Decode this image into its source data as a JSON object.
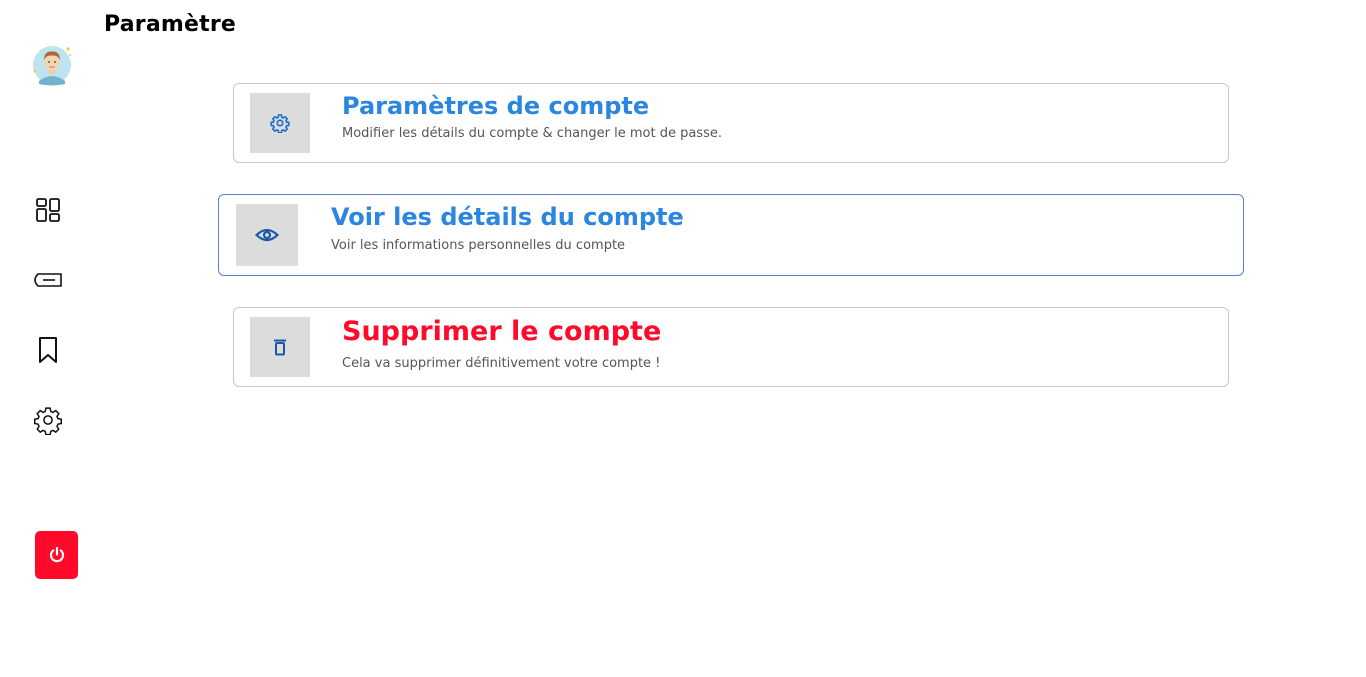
{
  "page": {
    "title": "Paramètre"
  },
  "sidebar": {
    "avatar": "avatar",
    "items": [
      {
        "name": "dashboard",
        "icon": "dashboard-icon"
      },
      {
        "name": "ticket",
        "icon": "ticket-icon"
      },
      {
        "name": "bookmark",
        "icon": "bookmark-icon"
      },
      {
        "name": "settings",
        "icon": "gear-icon"
      }
    ],
    "logout": {
      "icon": "power-icon",
      "color": "#ff0a2b"
    }
  },
  "cards": [
    {
      "title": "Paramètres de compte",
      "description": "Modifier les détails du compte & changer le mot de passe.",
      "icon": "gear-icon"
    },
    {
      "title": "Voir les détails du compte",
      "description": "Voir les informations personnelles du compte",
      "icon": "eye-icon"
    },
    {
      "title": "Supprimer le compte",
      "description": "Cela va supprimer définitivement votre compte !",
      "icon": "trash-icon"
    }
  ],
  "colors": {
    "accent": "#2a86de",
    "danger": "#ff0a2b",
    "icon_box": "#dcdcdc",
    "active_border": "#5a7fd6"
  }
}
